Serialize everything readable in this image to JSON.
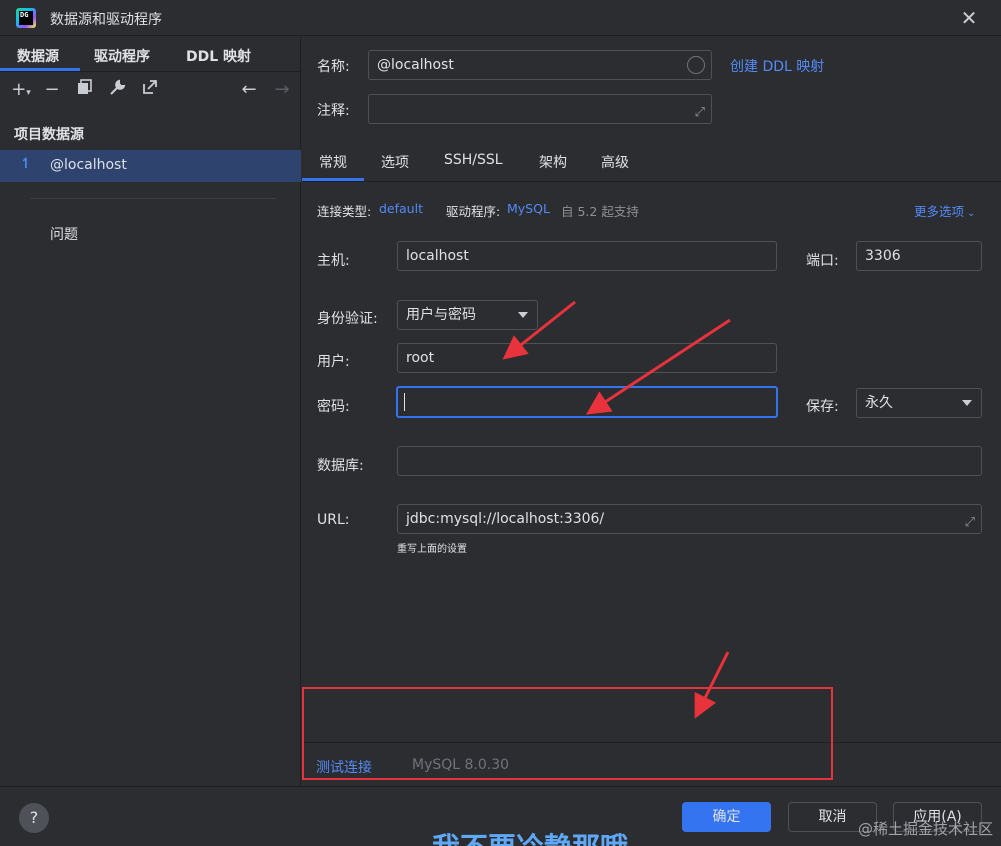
{
  "window": {
    "title": "数据源和驱动程序",
    "app_icon_text": "DG"
  },
  "left": {
    "tabs": [
      {
        "label": "数据源",
        "active": true
      },
      {
        "label": "驱动程序",
        "active": false
      },
      {
        "label": "DDL 映射",
        "active": false
      }
    ],
    "toolbar_icons": [
      "add-icon",
      "remove-icon",
      "duplicate-icon",
      "wrench-icon",
      "open-external-icon",
      "back-arrow-icon",
      "forward-arrow-icon"
    ],
    "section_title": "项目数据源",
    "datasource": {
      "label": "@localhost",
      "icon": "mysql-icon"
    },
    "problems_label": "问题"
  },
  "form": {
    "name_label": "名称:",
    "name_value": "@localhost",
    "create_ddl_link": "创建 DDL 映射",
    "comment_label": "注释:",
    "comment_value": "",
    "tabs": [
      {
        "label": "常规",
        "active": true
      },
      {
        "label": "选项",
        "active": false
      },
      {
        "label": "SSH/SSL",
        "active": false
      },
      {
        "label": "架构",
        "active": false
      },
      {
        "label": "高级",
        "active": false
      }
    ],
    "conn_type_label": "连接类型:",
    "conn_type_value": "default",
    "driver_label": "驱动程序:",
    "driver_value": "MySQL",
    "driver_note": "自 5.2 起支持",
    "more_options": "更多选项",
    "host_label": "主机:",
    "host_value": "localhost",
    "port_label": "端口:",
    "port_value": "3306",
    "auth_label": "身份验证:",
    "auth_value": "用户与密码",
    "user_label": "用户:",
    "user_value": "root",
    "password_label": "密码:",
    "password_value": "",
    "save_label": "保存:",
    "save_value": "永久",
    "database_label": "数据库:",
    "database_value": "",
    "url_label": "URL:",
    "url_value": "jdbc:mysql://localhost:3306/",
    "url_hint": "重写上面的设置"
  },
  "status": {
    "test_connection": "测试连接",
    "version": "MySQL 8.0.30"
  },
  "footer": {
    "help": "?",
    "ok": "确定",
    "cancel": "取消",
    "apply": "应用(A)"
  },
  "overlay": {
    "watermark": "@稀土掘金技术社区",
    "subtitle": "我不要冷静那哦",
    "annotation_color": "#e8323c"
  }
}
